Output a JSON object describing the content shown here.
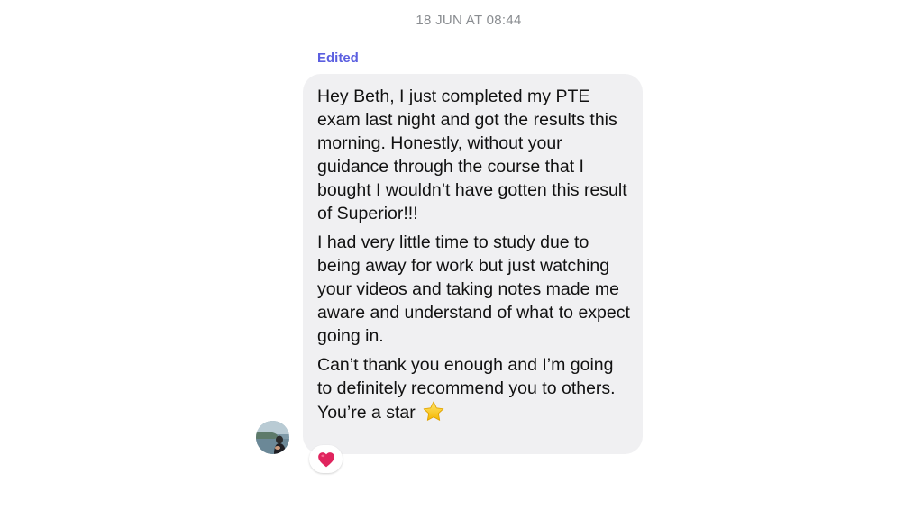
{
  "conversation": {
    "timestamp": "18 JUN AT 08:44",
    "edited_label": "Edited"
  },
  "message": {
    "paragraphs": [
      "Hey Beth, I just completed my PTE exam last night and got the results this morning. Honestly, without your guidance through the course that I bought I wouldn’t have gotten this result of Superior!!!",
      "I had very little time to study due to being away for work but just watching your videos and taking notes made me aware and understand of what to expect going in.",
      "Can’t thank you enough and I’m going to definitely recommend you to others. You’re a star"
    ],
    "trailing_emoji": "star-icon",
    "reaction": "heart-icon"
  },
  "sender": {
    "avatar": "avatar-photo"
  },
  "colors": {
    "bubble_background": "#f0f0f2",
    "edited_accent": "#5b5fe0",
    "timestamp_gray": "#8a8d91",
    "heart_red": "#e0245e",
    "star_yellow": "#ffd23f"
  }
}
